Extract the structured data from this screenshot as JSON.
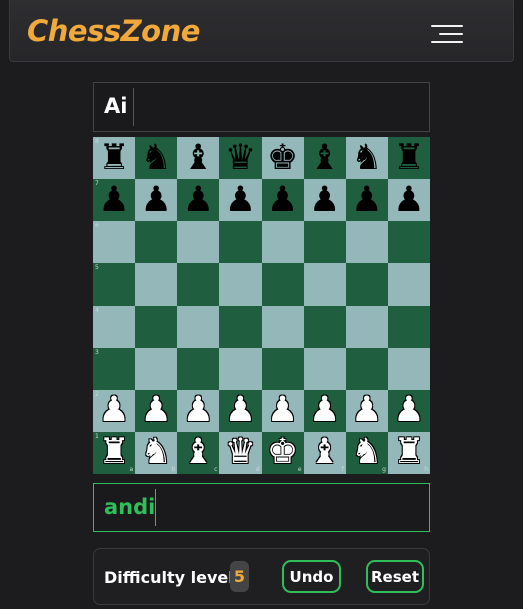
{
  "navbar": {
    "brand": "ChessZone",
    "menu_icon": "hamburger-menu-icon"
  },
  "players": {
    "top": {
      "name": "Ai"
    },
    "bottom": {
      "name": "andi"
    }
  },
  "board": {
    "light_color": "#94b8b9",
    "dark_color": "#1f5e3e",
    "rank_labels": [
      "8",
      "7",
      "6",
      "5",
      "4",
      "3",
      "2",
      "1"
    ],
    "file_labels": [
      "a",
      "b",
      "c",
      "d",
      "e",
      "f",
      "g",
      "h"
    ],
    "position": [
      [
        "bR",
        "bN",
        "bB",
        "bQ",
        "bK",
        "bB",
        "bN",
        "bR"
      ],
      [
        "bP",
        "bP",
        "bP",
        "bP",
        "bP",
        "bP",
        "bP",
        "bP"
      ],
      [
        "",
        "",
        "",
        "",
        "",
        "",
        "",
        ""
      ],
      [
        "",
        "",
        "",
        "",
        "",
        "",
        "",
        ""
      ],
      [
        "",
        "",
        "",
        "",
        "",
        "",
        "",
        ""
      ],
      [
        "",
        "",
        "",
        "",
        "",
        "",
        "",
        ""
      ],
      [
        "wP",
        "wP",
        "wP",
        "wP",
        "wP",
        "wP",
        "wP",
        "wP"
      ],
      [
        "wR",
        "wN",
        "wB",
        "wQ",
        "wK",
        "wB",
        "wN",
        "wR"
      ]
    ]
  },
  "controls": {
    "difficulty_label": "Difficulty level",
    "difficulty_value": "5",
    "undo_label": "Undo",
    "reset_label": "Reset"
  },
  "colors": {
    "accent": "#2fbf5a",
    "brand": "#f0a93a",
    "background": "#1c1c1e"
  }
}
